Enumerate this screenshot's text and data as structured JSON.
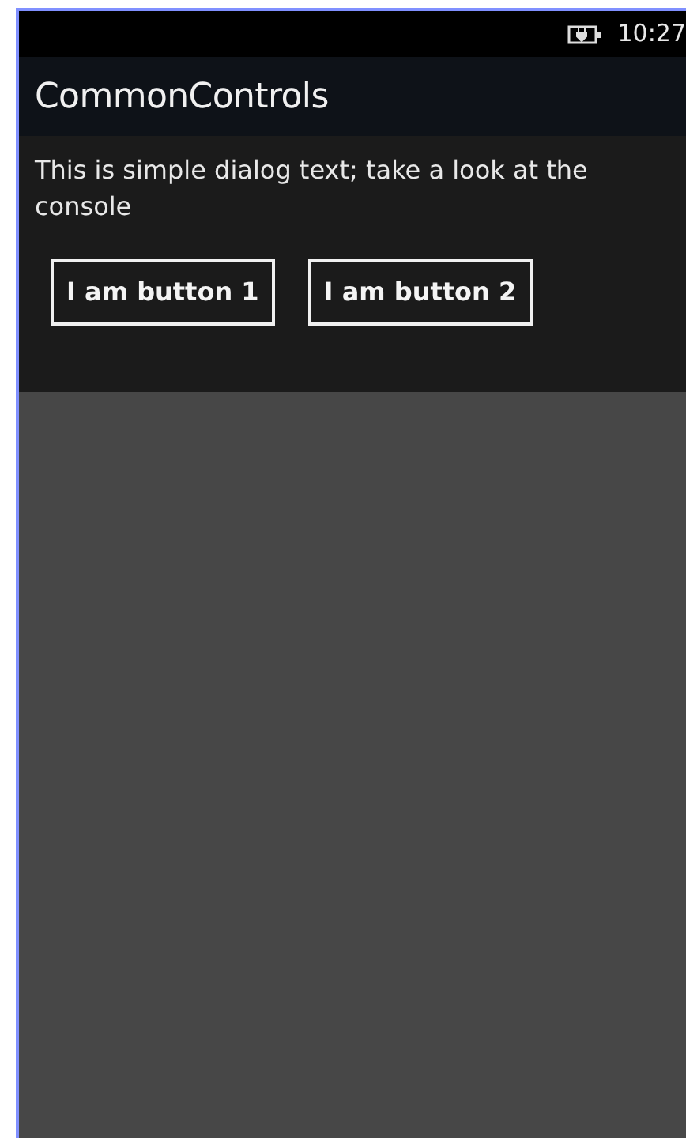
{
  "status_bar": {
    "time": "10:27"
  },
  "dialog": {
    "title": "CommonControls",
    "message": "This is simple dialog text; take a look at the console",
    "buttons": [
      "I am button 1",
      "I am button 2"
    ]
  }
}
